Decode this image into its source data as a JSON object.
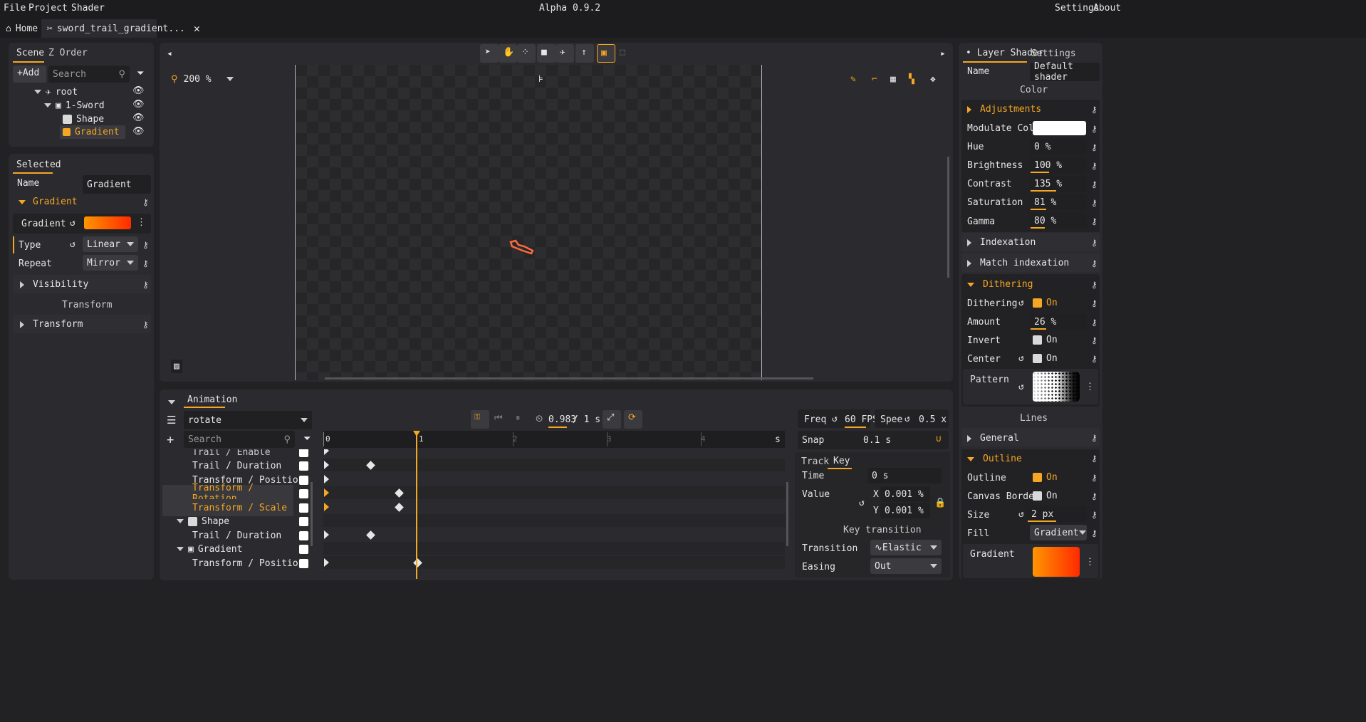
{
  "app": {
    "title": "Alpha 0.9.2",
    "menu": [
      "File",
      "Project",
      "Shader"
    ],
    "right_menu": [
      "Settings",
      "About"
    ]
  },
  "tabs": [
    {
      "label": "Home"
    },
    {
      "label": "sword_trail_gradient..."
    }
  ],
  "scene": {
    "tabs": [
      "Scene",
      "Z Order"
    ],
    "add_label": "Add",
    "search_placeholder": "Search",
    "tree": [
      {
        "label": "root"
      },
      {
        "label": "1-Sword"
      },
      {
        "label": "Shape"
      },
      {
        "label": "Gradient"
      }
    ]
  },
  "selected": {
    "header": "Selected",
    "name_label": "Name",
    "name_value": "Gradient",
    "gradient_section": "Gradient",
    "gradient_label": "Gradient",
    "type_label": "Type",
    "type_value": "Linear",
    "repeat_label": "Repeat",
    "repeat_value": "Mirror",
    "visibility": "Visibility",
    "transform_header": "Transform",
    "transform": "Transform"
  },
  "viewport": {
    "zoom": "200 %"
  },
  "animation": {
    "tab": "Animation",
    "anim_name": "rotate",
    "search_placeholder": "Search",
    "time": "0.983",
    "duration": "/ 1 s",
    "freq_label": "Freq",
    "freq_value": "60 FPS",
    "speed_label": "Spee",
    "speed_value": "0.5 x",
    "unit": "s",
    "ruler": [
      "0",
      "1",
      "2",
      "3",
      "4"
    ],
    "snap_label": "Snap",
    "snap_value": "0.1 s",
    "key_tabs": [
      "Track",
      "Key"
    ],
    "time_label": "Time",
    "time_value": "0 s",
    "value_label": "Value",
    "x_label": "X",
    "x_value": "0.001 %",
    "y_label": "Y",
    "y_value": "0.001 %",
    "key_transition": "Key transition",
    "transition_label": "Transition",
    "transition_value": "Elastic",
    "easing_label": "Easing",
    "easing_value": "Out",
    "tracks": [
      "Trail / Enable",
      "Trail / Duration",
      "Transform / Position",
      "Transform / Rotation",
      "Transform / Scale",
      "Shape",
      "Trail / Duration",
      "Gradient",
      "Transform / Position"
    ]
  },
  "shader": {
    "tabs": [
      "Layer Shader",
      "Settings"
    ],
    "name_label": "Name",
    "name_value": "Default shader",
    "color_header": "Color",
    "adjustments": "Adjustments",
    "modulate": "Modulate Color",
    "hue": "Hue",
    "hue_v": "0 %",
    "brightness": "Brightness",
    "brightness_v": "100 %",
    "contrast": "Contrast",
    "contrast_v": "135 %",
    "saturation": "Saturation",
    "saturation_v": "81 %",
    "gamma": "Gamma",
    "gamma_v": "80 %",
    "indexation": "Indexation",
    "match": "Match indexation",
    "dithering_section": "Dithering",
    "dithering": "Dithering",
    "on": "On",
    "amount": "Amount",
    "amount_v": "26 %",
    "invert": "Invert",
    "center": "Center",
    "pattern": "Pattern",
    "lines_header": "Lines",
    "general": "General",
    "outline_section": "Outline",
    "outline": "Outline",
    "canvas_border": "Canvas Border",
    "size": "Size",
    "size_v": "2 px",
    "fill": "Fill",
    "fill_v": "Gradient",
    "gradient": "Gradient"
  },
  "colors": {
    "accent": "#f5a623",
    "panel": "#2b2b2f",
    "bg": "#1c1c1e"
  }
}
